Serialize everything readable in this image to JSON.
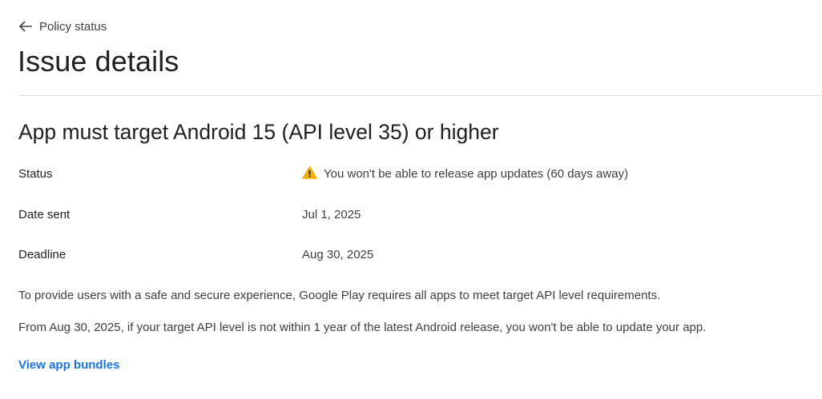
{
  "nav": {
    "back_label": "Policy status",
    "back_icon": "arrow-left-icon"
  },
  "page": {
    "title": "Issue details"
  },
  "issue": {
    "title": "App must target Android 15 (API level 35) or higher",
    "status": {
      "label": "Status",
      "value": "You won't be able to release app updates (60 days away)",
      "icon": "warning-icon",
      "icon_color": "#f9ab00"
    },
    "date_sent": {
      "label": "Date sent",
      "value": "Jul 1, 2025"
    },
    "deadline": {
      "label": "Deadline",
      "value": "Aug 30, 2025"
    },
    "paragraphs": [
      "To provide users with a safe and secure experience, Google Play requires all apps to meet target API level requirements.",
      "From Aug 30, 2025, if your target API level is not within 1 year of the latest Android release, you won't be able to update your app."
    ],
    "link_label": "View app bundles"
  },
  "colors": {
    "link": "#1a73e8",
    "divider": "#dadce0",
    "text_primary": "#202124",
    "text_secondary": "#3c4043"
  }
}
